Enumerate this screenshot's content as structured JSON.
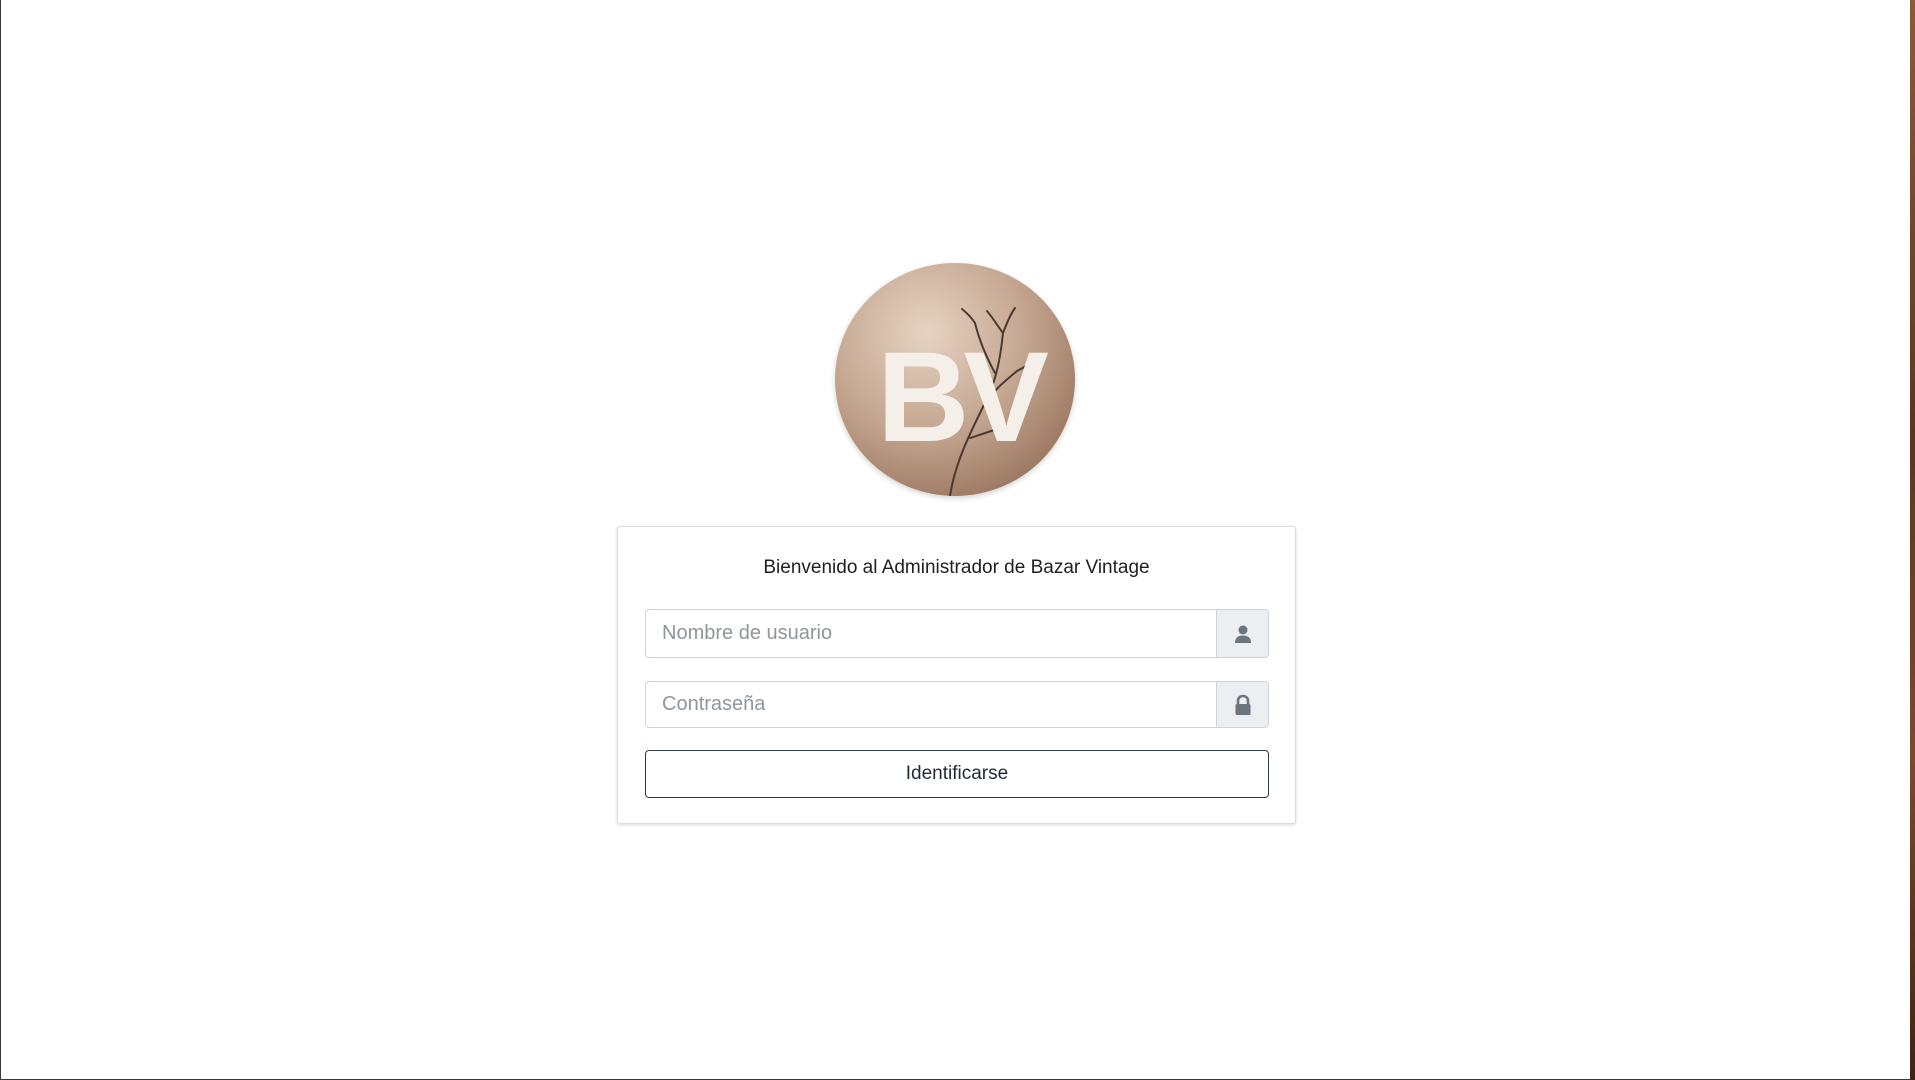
{
  "logo": {
    "text": "BV",
    "background": "#b08f79",
    "letter_color": "#f4efe9"
  },
  "login": {
    "title": "Bienvenido al Administrador de Bazar Vintage",
    "username_placeholder": "Nombre de usuario",
    "password_placeholder": "Contraseña",
    "submit_label": "Identificarse",
    "username_icon": "user-icon",
    "password_icon": "lock-icon"
  },
  "colors": {
    "button_border": "#2e3a45",
    "addon_background": "#eceff1",
    "icon_color": "#6c757d"
  }
}
